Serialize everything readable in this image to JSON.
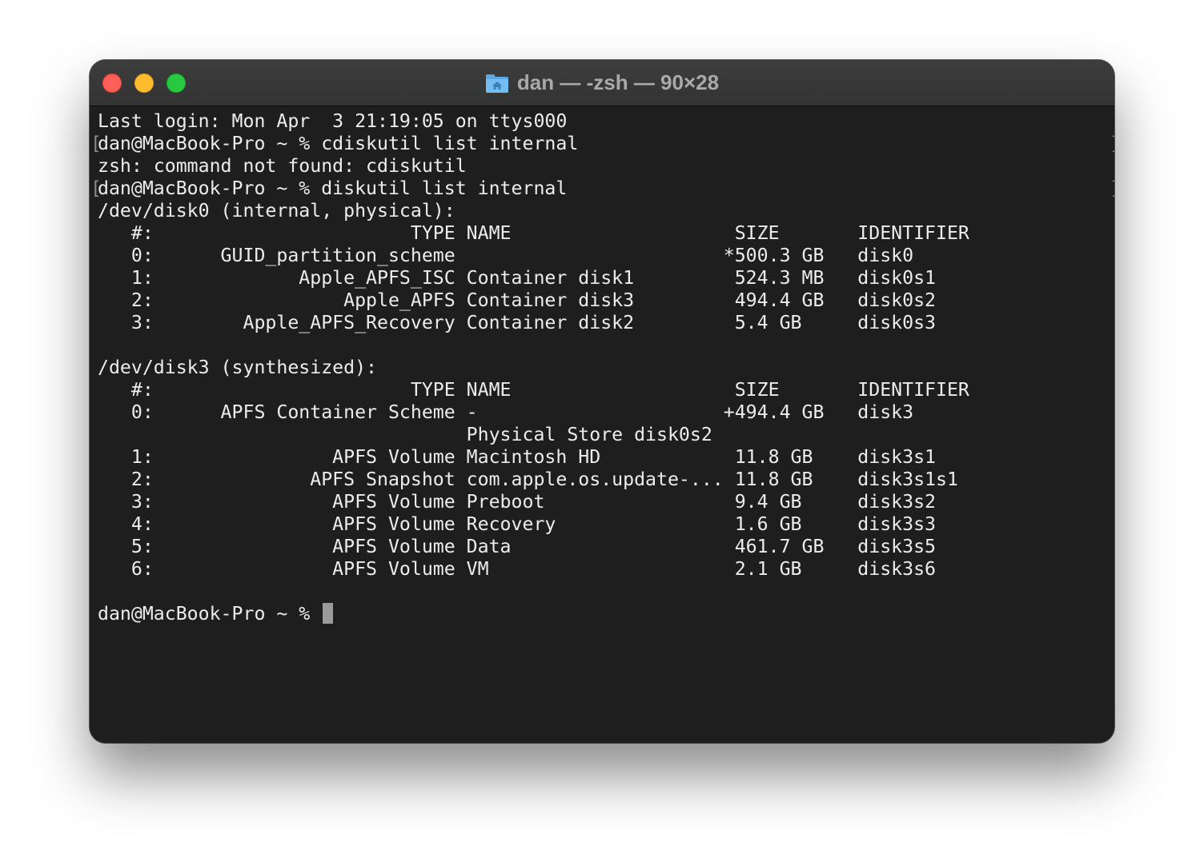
{
  "window": {
    "title": "dan — -zsh — 90×28",
    "folder_icon": "folder-home-icon"
  },
  "terminal": {
    "lines": [
      "Last login: Mon Apr  3 21:19:05 on ttys000",
      "dan@MacBook-Pro ~ % cdiskutil list internal",
      "zsh: command not found: cdiskutil",
      "dan@MacBook-Pro ~ % diskutil list internal",
      "/dev/disk0 (internal, physical):",
      "   #:                       TYPE NAME                    SIZE       IDENTIFIER",
      "   0:      GUID_partition_scheme                        *500.3 GB   disk0",
      "   1:             Apple_APFS_ISC Container disk1         524.3 MB   disk0s1",
      "   2:                 Apple_APFS Container disk3         494.4 GB   disk0s2",
      "   3:        Apple_APFS_Recovery Container disk2         5.4 GB     disk0s3",
      "",
      "/dev/disk3 (synthesized):",
      "   #:                       TYPE NAME                    SIZE       IDENTIFIER",
      "   0:      APFS Container Scheme -                      +494.4 GB   disk3",
      "                                 Physical Store disk0s2",
      "   1:                APFS Volume Macintosh HD            11.8 GB    disk3s1",
      "   2:              APFS Snapshot com.apple.os.update-... 11.8 GB    disk3s1s1",
      "   3:                APFS Volume Preboot                 9.4 GB     disk3s2",
      "   4:                APFS Volume Recovery                1.6 GB     disk3s3",
      "   5:                APFS Volume Data                    461.7 GB   disk3s5",
      "   6:                APFS Volume VM                      2.1 GB     disk3s6",
      "",
      "dan@MacBook-Pro ~ % "
    ],
    "left_bracket": "[",
    "right_bracket": "]"
  }
}
